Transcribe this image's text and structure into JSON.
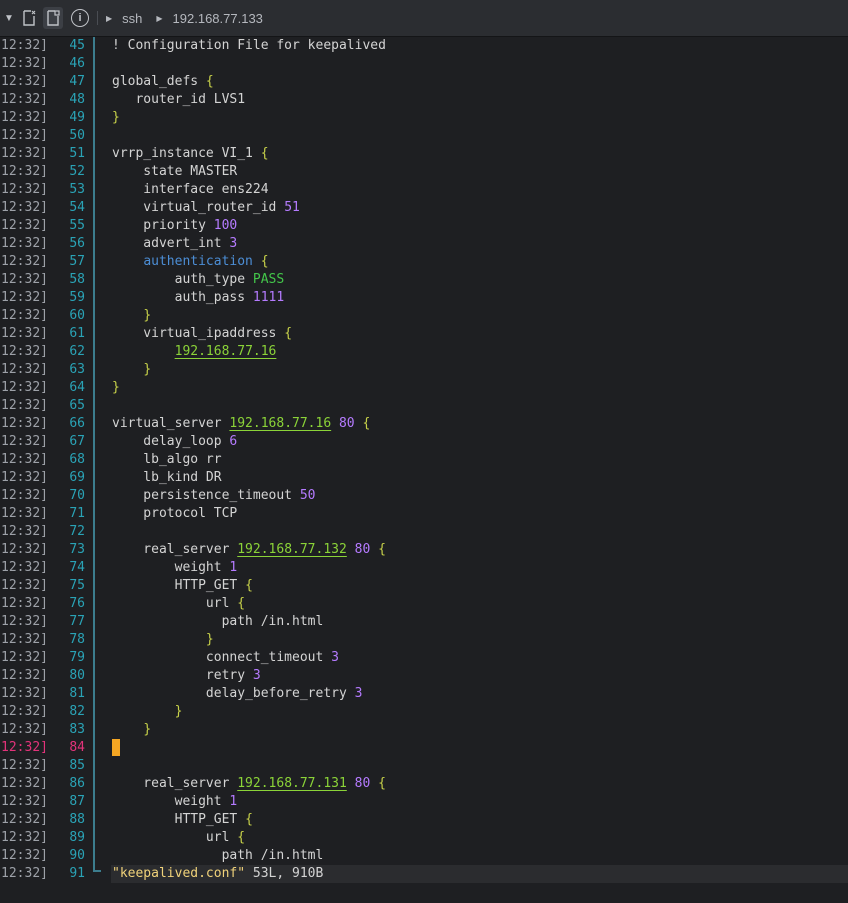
{
  "toolbar": {
    "collapse_icon": "chevron-down-icon",
    "btn1_icon": "document-icon",
    "btn2_icon": "document-active-icon",
    "info_icon": "info-icon",
    "info_glyph": "i",
    "crumb_1": "ssh",
    "crumb_2": "192.168.77.133"
  },
  "editor": {
    "timestamp": "12:32]",
    "lines": [
      {
        "n": "45",
        "t": "! Configuration File for keepalived"
      },
      {
        "n": "46",
        "t": ""
      },
      {
        "n": "47",
        "t": "global_defs {"
      },
      {
        "n": "48",
        "t": "   router_id LVS1"
      },
      {
        "n": "49",
        "t": "}"
      },
      {
        "n": "50",
        "t": ""
      },
      {
        "n": "51",
        "t": "vrrp_instance VI_1 {"
      },
      {
        "n": "52",
        "t": "    state MASTER"
      },
      {
        "n": "53",
        "t": "    interface ens224"
      },
      {
        "n": "54",
        "t": "    virtual_router_id 51"
      },
      {
        "n": "55",
        "t": "    priority 100"
      },
      {
        "n": "56",
        "t": "    advert_int 3"
      },
      {
        "n": "57",
        "t": "    authentication {"
      },
      {
        "n": "58",
        "t": "        auth_type PASS"
      },
      {
        "n": "59",
        "t": "        auth_pass 1111"
      },
      {
        "n": "60",
        "t": "    }"
      },
      {
        "n": "61",
        "t": "    virtual_ipaddress {"
      },
      {
        "n": "62",
        "t": "        192.168.77.16"
      },
      {
        "n": "63",
        "t": "    }"
      },
      {
        "n": "64",
        "t": "}"
      },
      {
        "n": "65",
        "t": ""
      },
      {
        "n": "66",
        "t": "virtual_server 192.168.77.16 80 {"
      },
      {
        "n": "67",
        "t": "    delay_loop 6"
      },
      {
        "n": "68",
        "t": "    lb_algo rr"
      },
      {
        "n": "69",
        "t": "    lb_kind DR"
      },
      {
        "n": "70",
        "t": "    persistence_timeout 50"
      },
      {
        "n": "71",
        "t": "    protocol TCP"
      },
      {
        "n": "72",
        "t": ""
      },
      {
        "n": "73",
        "t": "    real_server 192.168.77.132 80 {"
      },
      {
        "n": "74",
        "t": "        weight 1"
      },
      {
        "n": "75",
        "t": "        HTTP_GET {"
      },
      {
        "n": "76",
        "t": "            url {"
      },
      {
        "n": "77",
        "t": "              path /in.html"
      },
      {
        "n": "78",
        "t": "            }"
      },
      {
        "n": "79",
        "t": "            connect_timeout 3"
      },
      {
        "n": "80",
        "t": "            retry 3"
      },
      {
        "n": "81",
        "t": "            delay_before_retry 3"
      },
      {
        "n": "82",
        "t": "        }"
      },
      {
        "n": "83",
        "t": "    }"
      },
      {
        "n": "84",
        "t": "",
        "current": true
      },
      {
        "n": "85",
        "t": ""
      },
      {
        "n": "86",
        "t": "    real_server 192.168.77.131 80 {"
      },
      {
        "n": "87",
        "t": "        weight 1"
      },
      {
        "n": "88",
        "t": "        HTTP_GET {"
      },
      {
        "n": "89",
        "t": "            url {"
      },
      {
        "n": "90",
        "t": "              path /in.html"
      }
    ],
    "status_line": {
      "n": "91",
      "filename": "\"keepalived.conf\"",
      "info": " 53L, 910B"
    }
  },
  "colors": {
    "background": "#1e1f22",
    "line_number": "#2aa3b6",
    "current_line": "#e2337a",
    "brace": "#c8d24a",
    "number": "#b57bff",
    "string": "#43c64a",
    "keyword": "#4c8ed6",
    "ip": "#8bd338",
    "cursor": "#f5a623"
  }
}
